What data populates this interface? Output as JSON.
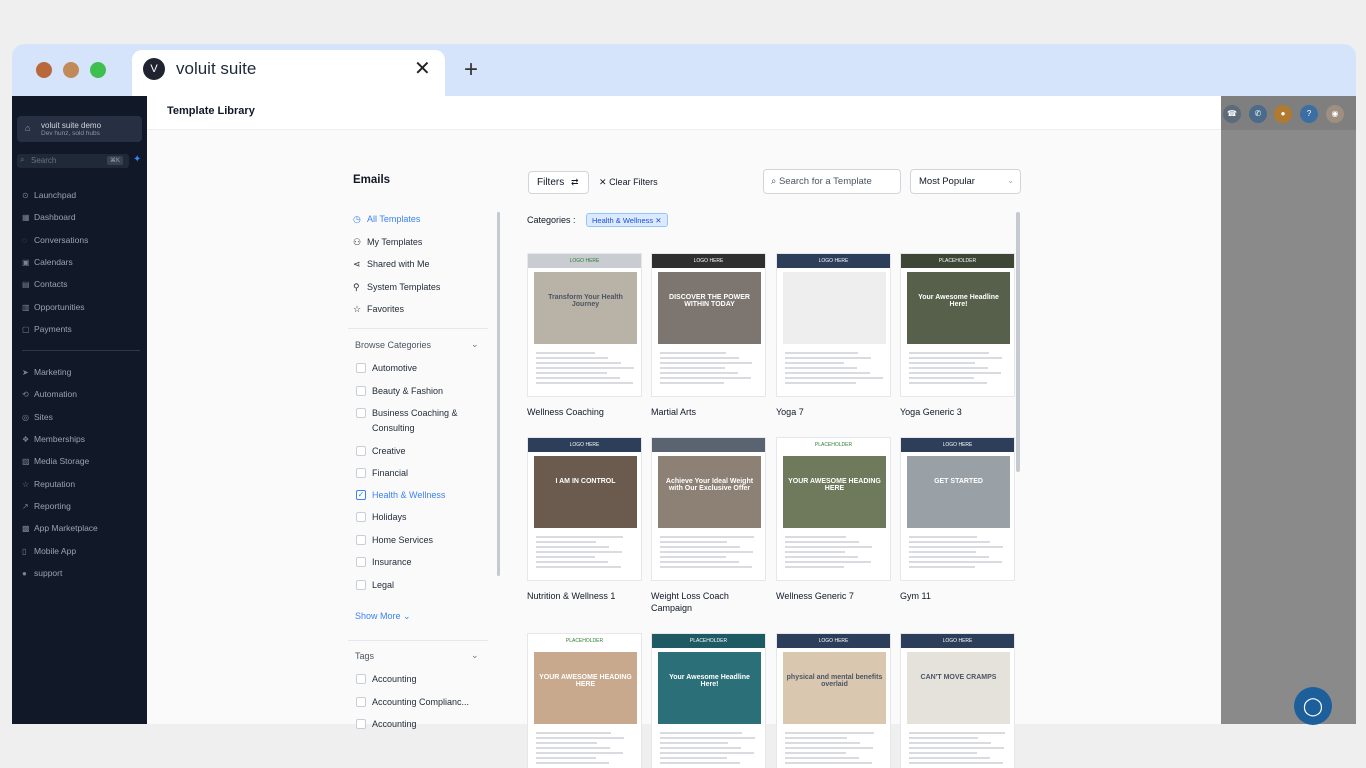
{
  "browser": {
    "tab_title": "voluit suite",
    "tab_close": "✕",
    "new_tab": "+"
  },
  "sidebar": {
    "account_name": "voluit suite demo",
    "account_sub": "Dev hunz, sold hubs",
    "search_placeholder": "Search",
    "search_shortcut": "⌘K",
    "items": [
      {
        "label": "Launchpad",
        "icon": "rocket-icon"
      },
      {
        "label": "Dashboard",
        "icon": "grid-icon"
      },
      {
        "label": "Conversations",
        "icon": "chat-icon"
      },
      {
        "label": "Calendars",
        "icon": "calendar-icon"
      },
      {
        "label": "Contacts",
        "icon": "contacts-icon"
      },
      {
        "label": "Opportunities",
        "icon": "funnel-icon"
      },
      {
        "label": "Payments",
        "icon": "card-icon"
      },
      {
        "label": "Marketing",
        "icon": "send-icon"
      },
      {
        "label": "Automation",
        "icon": "automation-icon"
      },
      {
        "label": "Sites",
        "icon": "globe-icon"
      },
      {
        "label": "Memberships",
        "icon": "badge-icon"
      },
      {
        "label": "Media Storage",
        "icon": "image-icon"
      },
      {
        "label": "Reputation",
        "icon": "star-icon"
      },
      {
        "label": "Reporting",
        "icon": "chart-icon"
      },
      {
        "label": "App Marketplace",
        "icon": "apps-icon"
      },
      {
        "label": "Mobile App",
        "icon": "phone-icon"
      },
      {
        "label": "support",
        "icon": "help-icon"
      }
    ]
  },
  "main": {
    "title": "Template Library"
  },
  "filters_panel": {
    "title": "Emails",
    "nav": [
      {
        "label": "All Templates",
        "icon": "clock-icon",
        "active": true
      },
      {
        "label": "My Templates",
        "icon": "user-icon",
        "active": false
      },
      {
        "label": "Shared with Me",
        "icon": "share-icon",
        "active": false
      },
      {
        "label": "System Templates",
        "icon": "wrench-icon",
        "active": false
      },
      {
        "label": "Favorites",
        "icon": "star-icon",
        "active": false
      }
    ],
    "browse_heading": "Browse Categories",
    "categories": [
      {
        "label": "Automotive",
        "checked": false
      },
      {
        "label": "Beauty & Fashion",
        "checked": false
      },
      {
        "label": "Business Coaching &",
        "label2": "Consulting",
        "checked": false
      },
      {
        "label": "Creative",
        "checked": false
      },
      {
        "label": "Financial",
        "checked": false
      },
      {
        "label": "Health & Wellness",
        "checked": true
      },
      {
        "label": "Holidays",
        "checked": false
      },
      {
        "label": "Home Services",
        "checked": false
      },
      {
        "label": "Insurance",
        "checked": false
      },
      {
        "label": "Legal",
        "checked": false
      }
    ],
    "show_more": "Show More",
    "tags_heading": "Tags",
    "tags": [
      {
        "label": "Accounting",
        "checked": false
      },
      {
        "label": "Accounting Complianc...",
        "checked": false
      },
      {
        "label": "Accounting",
        "checked": false
      }
    ]
  },
  "toolbar": {
    "filters_label": "Filters",
    "clear_label": "Clear Filters",
    "search_placeholder": "Search for a Template",
    "sort_value": "Most Popular",
    "categories_label": "Categories",
    "active_chip": "Health & Wellness"
  },
  "templates": [
    {
      "name": "Wellness Coaching",
      "name2": "",
      "bar": "LOGO HERE",
      "bar_color": "#c9ccd0",
      "photo": "#b9b2a7",
      "headline": "Transform Your Health Journey"
    },
    {
      "name": "Martial Arts",
      "name2": "",
      "bar": "LOGO HERE",
      "bar_color": "#2f2f2f",
      "photo": "#7d7670",
      "headline": "DISCOVER THE POWER WITHIN TODAY"
    },
    {
      "name": "Yoga 7",
      "name2": "",
      "bar": "LOGO HERE",
      "bar_color": "#2c3e5a",
      "photo": "#eeeeee",
      "headline": ""
    },
    {
      "name": "Yoga Generic 3",
      "name2": "",
      "bar": "PLACEHOLDER",
      "bar_color": "#3e4636",
      "photo": "#56604b",
      "headline": "Your Awesome Headline Here!"
    },
    {
      "name": "Nutrition & Wellness 1",
      "name2": "",
      "bar": "LOGO HERE",
      "bar_color": "#2c3e5a",
      "photo": "#6a5b4e",
      "headline": "I AM IN CONTROL"
    },
    {
      "name": "Weight Loss Coach",
      "name2": "Campaign",
      "bar": "",
      "bar_color": "#5a6470",
      "photo": "#8d8176",
      "headline": "Achieve Your Ideal Weight with Our Exclusive Offer"
    },
    {
      "name": "Wellness Generic 7",
      "name2": "",
      "bar": "PLACEHOLDER",
      "bar_color": "#ffffff",
      "photo": "#6f7a5c",
      "headline": "YOUR AWESOME HEADING HERE"
    },
    {
      "name": "Gym 11",
      "name2": "",
      "bar": "LOGO HERE",
      "bar_color": "#2c3e5a",
      "photo": "#9aa1a6",
      "headline": "GET STARTED"
    },
    {
      "name": "",
      "name2": "",
      "bar": "PLACEHOLDER",
      "bar_color": "#ffffff",
      "photo": "#c9a98d",
      "headline": "YOUR AWESOME HEADING HERE"
    },
    {
      "name": "",
      "name2": "",
      "bar": "PLACEHOLDER",
      "bar_color": "#1e5a63",
      "photo": "#2b6f78",
      "headline": "Your Awesome Headline Here!"
    },
    {
      "name": "",
      "name2": "",
      "bar": "LOGO HERE",
      "bar_color": "#2c3e5a",
      "photo": "#d9c7b0",
      "headline": "physical and mental benefits overlaid"
    },
    {
      "name": "",
      "name2": "",
      "bar": "LOGO HERE",
      "bar_color": "#2c3e5a",
      "photo": "#e5e2dc",
      "headline": "CAN'T MOVE CRAMPS"
    }
  ],
  "colors": {
    "accent": "#3b82f6",
    "sidebar_bg": "#111827",
    "tabbar_bg": "#d6e4fb"
  }
}
